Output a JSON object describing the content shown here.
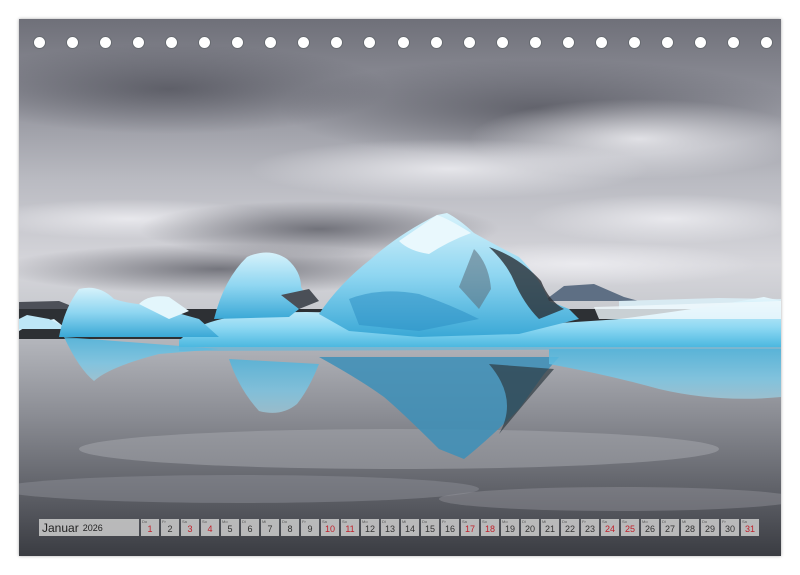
{
  "calendar": {
    "month": "Januar",
    "year": "2026",
    "days": [
      {
        "wd": "Do",
        "num": "1",
        "red": true
      },
      {
        "wd": "Fr",
        "num": "2",
        "red": false
      },
      {
        "wd": "Sa",
        "num": "3",
        "red": true
      },
      {
        "wd": "So",
        "num": "4",
        "red": true
      },
      {
        "wd": "Mo",
        "num": "5",
        "red": false
      },
      {
        "wd": "Di",
        "num": "6",
        "red": false
      },
      {
        "wd": "Mi",
        "num": "7",
        "red": false
      },
      {
        "wd": "Do",
        "num": "8",
        "red": false
      },
      {
        "wd": "Fr",
        "num": "9",
        "red": false
      },
      {
        "wd": "Sa",
        "num": "10",
        "red": true
      },
      {
        "wd": "So",
        "num": "11",
        "red": true
      },
      {
        "wd": "Mo",
        "num": "12",
        "red": false
      },
      {
        "wd": "Di",
        "num": "13",
        "red": false
      },
      {
        "wd": "Mi",
        "num": "14",
        "red": false
      },
      {
        "wd": "Do",
        "num": "15",
        "red": false
      },
      {
        "wd": "Fr",
        "num": "16",
        "red": false
      },
      {
        "wd": "Sa",
        "num": "17",
        "red": true
      },
      {
        "wd": "So",
        "num": "18",
        "red": true
      },
      {
        "wd": "Mo",
        "num": "19",
        "red": false
      },
      {
        "wd": "Di",
        "num": "20",
        "red": false
      },
      {
        "wd": "Mi",
        "num": "21",
        "red": false
      },
      {
        "wd": "Do",
        "num": "22",
        "red": false
      },
      {
        "wd": "Fr",
        "num": "23",
        "red": false
      },
      {
        "wd": "Sa",
        "num": "24",
        "red": true
      },
      {
        "wd": "So",
        "num": "25",
        "red": true
      },
      {
        "wd": "Mo",
        "num": "26",
        "red": false
      },
      {
        "wd": "Di",
        "num": "27",
        "red": false
      },
      {
        "wd": "Mi",
        "num": "28",
        "red": false
      },
      {
        "wd": "Do",
        "num": "29",
        "red": false
      },
      {
        "wd": "Fr",
        "num": "30",
        "red": false
      },
      {
        "wd": "Sa",
        "num": "31",
        "red": true
      }
    ]
  },
  "binding_hole_count": 23,
  "colors": {
    "holiday_red": "#c0202a",
    "ice_blue": "#7fd0ee",
    "sky_grey": "#9a9ba3"
  }
}
